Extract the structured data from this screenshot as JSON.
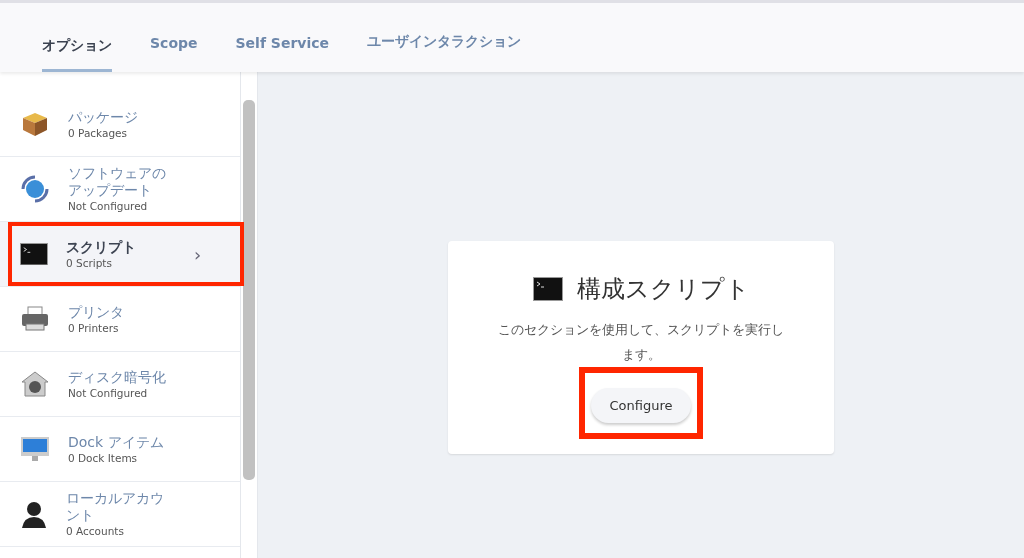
{
  "tabs": [
    {
      "label": "オプション",
      "selected": true
    },
    {
      "label": "Scope",
      "selected": false
    },
    {
      "label": "Self Service",
      "selected": false
    },
    {
      "label": "ユーザインタラクション",
      "selected": false
    }
  ],
  "sidebar": {
    "items": [
      {
        "kind": "package",
        "title": "パッケージ",
        "subtitle": "0 Packages",
        "selected": false,
        "highlighted": false
      },
      {
        "kind": "update",
        "title": "ソフトウェアのアップデート",
        "subtitle": "Not Configured",
        "selected": false,
        "highlighted": false
      },
      {
        "kind": "script",
        "title": "スクリプト",
        "subtitle": "0 Scripts",
        "selected": true,
        "highlighted": true,
        "chevron": "›"
      },
      {
        "kind": "printer",
        "title": "プリンタ",
        "subtitle": "0 Printers",
        "selected": false,
        "highlighted": false
      },
      {
        "kind": "disk",
        "title": "ディスク暗号化",
        "subtitle": "Not Configured",
        "selected": false,
        "highlighted": false
      },
      {
        "kind": "dock",
        "title": "Dock アイテム",
        "subtitle": "0 Dock Items",
        "selected": false,
        "highlighted": false
      },
      {
        "kind": "account",
        "title": "ローカルアカウント",
        "subtitle": "0 Accounts",
        "selected": false,
        "highlighted": false
      }
    ]
  },
  "card": {
    "title": "構成スクリプト",
    "description": "このセクションを使用して、スクリプトを実行します。",
    "button": {
      "label": "Configure",
      "highlighted": true
    }
  }
}
